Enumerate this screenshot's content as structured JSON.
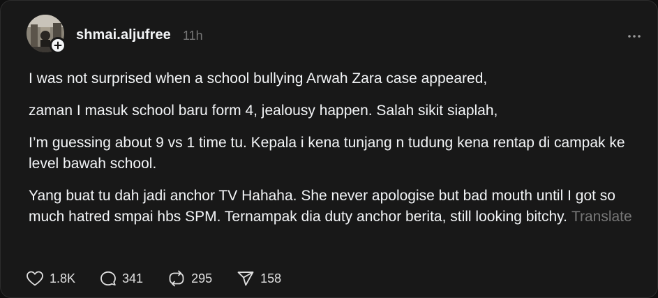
{
  "post": {
    "username": "shmai.aljufree",
    "timestamp": "11h",
    "paragraphs": [
      "I was not surprised when a school bullying Arwah Zara case appeared,",
      "zaman I masuk school baru form 4, jealousy happen. Salah sikit siaplah,",
      "I’m guessing about 9 vs 1 time tu. Kepala i kena tunjang n tudung kena rentap di campak ke level bawah school.",
      "Yang buat tu dah jadi anchor TV Hahaha. She never apologise but bad mouth until I got so much hatred smpai hbs SPM. Ternampak dia duty anchor berita, still looking bitchy."
    ],
    "translate_label": "Translate",
    "actions": {
      "likes": "1.8K",
      "replies": "341",
      "reposts": "295",
      "shares": "158"
    }
  },
  "icons": {
    "avatar": "profile-photo",
    "follow": "plus-icon",
    "more": "more-horizontal-icon",
    "like": "heart-icon",
    "reply": "comment-bubble-icon",
    "repost": "repost-icon",
    "share": "send-icon"
  },
  "colors": {
    "background": "#101010",
    "card": "#181818",
    "text": "#f3f5f7",
    "muted": "#777777"
  }
}
